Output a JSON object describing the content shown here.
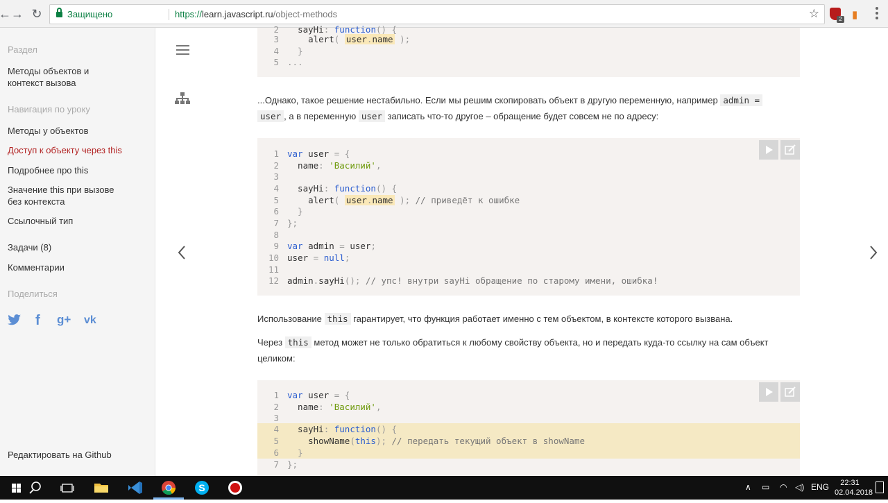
{
  "browser": {
    "secure_label": "Защищено",
    "url_scheme": "https://",
    "url_host": "learn.javascript.ru",
    "url_path": "/object-methods",
    "ext_badge": "2"
  },
  "sidebar": {
    "section_heading": "Раздел",
    "section_link": "Методы объектов и контекст вызова",
    "nav_heading": "Навигация по уроку",
    "nav": [
      "Методы у объектов",
      "Доступ к объекту через this",
      "Подробнее про this",
      "Значение this при вызове без контекста",
      "Ссылочный тип"
    ],
    "tasks": "Задачи (8)",
    "comments": "Комментарии",
    "share_heading": "Поделиться",
    "social": [
      "twitter",
      "facebook",
      "google-plus",
      "vk"
    ],
    "github": "Редактировать на Github"
  },
  "content": {
    "block1": [
      {
        "n": "2",
        "code": "sayHi: function() {"
      },
      {
        "n": "3",
        "code": "alert( user.name );"
      },
      {
        "n": "4",
        "code": "}"
      },
      {
        "n": "5",
        "code": "..."
      }
    ],
    "para1": {
      "t1": "...Однако, такое решение нестабильно. Если мы решим скопировать объект в другую переменную, например",
      "c1": "admin =",
      "c2": "user",
      "t2": ", а в переменную",
      "c3": "user",
      "t3": "записать что-то другое – обращение будет совсем не по адресу:"
    },
    "block2": [
      {
        "n": "1",
        "code": "var user = {"
      },
      {
        "n": "2",
        "code": "name: 'Василий',"
      },
      {
        "n": "3",
        "code": ""
      },
      {
        "n": "4",
        "code": "sayHi: function() {"
      },
      {
        "n": "5",
        "code": "alert( user.name ); // приведёт к ошибке"
      },
      {
        "n": "6",
        "code": "}"
      },
      {
        "n": "7",
        "code": "};"
      },
      {
        "n": "8",
        "code": ""
      },
      {
        "n": "9",
        "code": "var admin = user;"
      },
      {
        "n": "10",
        "code": "user = null;"
      },
      {
        "n": "11",
        "code": ""
      },
      {
        "n": "12",
        "code": "admin.sayHi(); // упс! внутри sayHi обращение по старому имени, ошибка!"
      }
    ],
    "para2": {
      "t1": "Использование",
      "c1": "this",
      "t2": "гарантирует, что функция работает именно с тем объектом, в контексте которого вызвана."
    },
    "para3": {
      "t1": "Через",
      "c1": "this",
      "t2": "метод может не только обратиться к любому свойству объекта, но и передать куда-то ссылку на сам объект",
      "t3": "целиком:"
    },
    "block3": [
      {
        "n": "1",
        "code": "var user = {"
      },
      {
        "n": "2",
        "code": "name: 'Василий',"
      },
      {
        "n": "3",
        "code": ""
      },
      {
        "n": "4",
        "code": "sayHi: function() {"
      },
      {
        "n": "5",
        "code": "showName(this); // передать текущий объект в showName"
      },
      {
        "n": "6",
        "code": "}"
      },
      {
        "n": "7",
        "code": "};"
      }
    ]
  },
  "taskbar": {
    "lang": "ENG",
    "time": "22:31",
    "date": "02.04.2018"
  }
}
